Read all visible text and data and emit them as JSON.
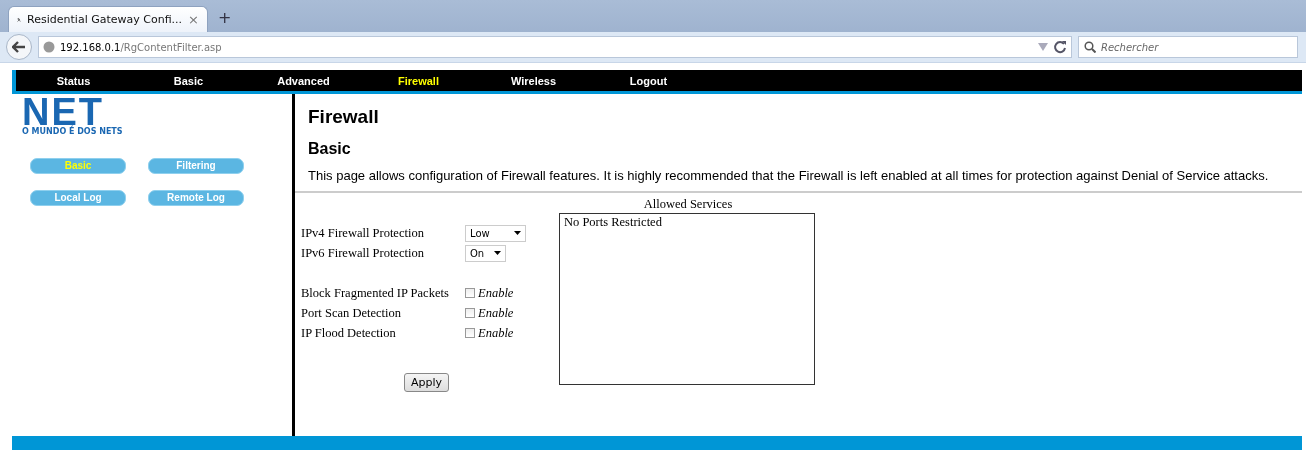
{
  "browser": {
    "tab": {
      "title": "Residential Gateway Confi...",
      "close": "×"
    },
    "new_tab": "+",
    "address": {
      "host": "192.168.0.1",
      "path": "/RgContentFilter.asp"
    },
    "search": {
      "placeholder": "Rechercher"
    }
  },
  "nav": [
    {
      "label": "Status",
      "selected": false
    },
    {
      "label": "Basic",
      "selected": false
    },
    {
      "label": "Advanced",
      "selected": false
    },
    {
      "label": "Firewall",
      "selected": true
    },
    {
      "label": "Wireless",
      "selected": false
    },
    {
      "label": "Logout",
      "selected": false
    }
  ],
  "logo": {
    "wordmark": "NET",
    "tagline": "O MUNDO É DOS NETS"
  },
  "sidebar": [
    {
      "label": "Basic",
      "selected": true
    },
    {
      "label": "Filtering",
      "selected": false
    },
    {
      "label": "Local Log",
      "selected": false
    },
    {
      "label": "Remote Log",
      "selected": false
    }
  ],
  "page": {
    "title": "Firewall",
    "subtitle": "Basic",
    "description": "This page allows configuration of Firewall features. It is highly recommended that the Firewall is left enabled at all times for protection against Denial of Service attacks."
  },
  "selects": [
    {
      "label": "IPv4 Firewall Protection",
      "value": "Low"
    },
    {
      "label": "IPv6 Firewall Protection",
      "value": "On"
    }
  ],
  "options": [
    {
      "label": "Block Fragmented IP Packets",
      "checkbox_label": "Enable",
      "checked": false
    },
    {
      "label": "Port Scan Detection",
      "checkbox_label": "Enable",
      "checked": false
    },
    {
      "label": "IP Flood Detection",
      "checkbox_label": "Enable",
      "checked": false
    }
  ],
  "allowed_services": {
    "title": "Allowed Services",
    "items": [
      "No Ports Restricted"
    ]
  },
  "apply_button": "Apply"
}
